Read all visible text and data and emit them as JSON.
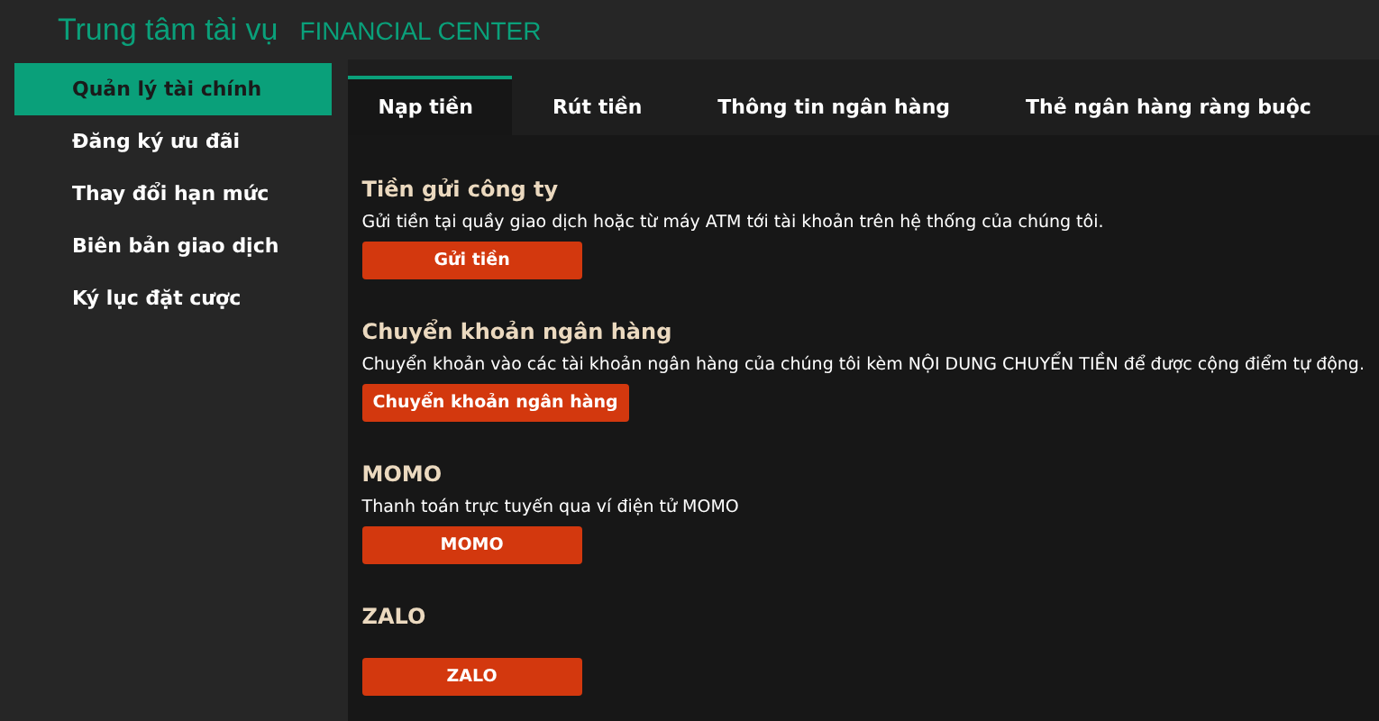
{
  "header": {
    "title": "Trung tâm tài vụ",
    "subtitle": "FINANCIAL CENTER"
  },
  "sidebar": {
    "items": [
      {
        "label": "Quản lý tài chính",
        "selected": true
      },
      {
        "label": "Đăng ký ưu đãi",
        "selected": false
      },
      {
        "label": "Thay đổi hạn mức",
        "selected": false
      },
      {
        "label": "Biên bản giao dịch",
        "selected": false
      },
      {
        "label": "Ký lục đặt cược",
        "selected": false
      }
    ]
  },
  "tabs": [
    {
      "label": "Nạp tiền",
      "selected": true
    },
    {
      "label": "Rút tiền",
      "selected": false
    },
    {
      "label": "Thông tin ngân hàng",
      "selected": false
    },
    {
      "label": "Thẻ ngân hàng ràng buộc",
      "selected": false
    }
  ],
  "sections": [
    {
      "heading": "Tiền gửi công ty",
      "description": "Gửi tiền tại quầy giao dịch hoặc từ máy ATM tới tài khoản trên hệ thống của chúng tôi.",
      "button": "Gửi tiền"
    },
    {
      "heading": "Chuyển khoản ngân hàng",
      "description": "Chuyển khoản vào các tài khoản ngân hàng của chúng tôi kèm NỘI DUNG CHUYỂN TIỀN để được cộng điểm tự động.",
      "button": "Chuyển khoản ngân hàng"
    },
    {
      "heading": "MOMO",
      "description": "Thanh toán trực tuyến qua ví điện tử MOMO",
      "button": "MOMO"
    },
    {
      "heading": "ZALO",
      "button": "ZALO"
    }
  ]
}
